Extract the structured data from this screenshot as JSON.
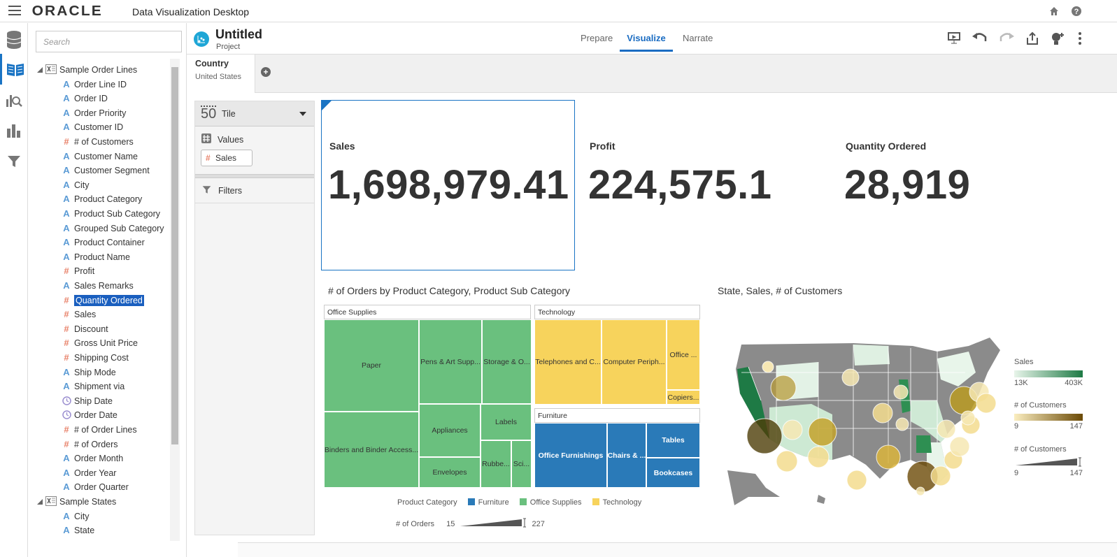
{
  "app": {
    "brand": "ORACLE",
    "name": "Data Visualization Desktop"
  },
  "top_icons": [
    "home-icon",
    "help-icon"
  ],
  "search": {
    "placeholder": "Search"
  },
  "tree": {
    "groups": [
      {
        "label": "Sample Order Lines",
        "expanded": true
      },
      {
        "label": "Sample States",
        "expanded": true
      }
    ],
    "items1": [
      {
        "type": "A",
        "label": "Order Line ID"
      },
      {
        "type": "A",
        "label": "Order ID"
      },
      {
        "type": "A",
        "label": "Order Priority"
      },
      {
        "type": "A",
        "label": "Customer ID"
      },
      {
        "type": "#",
        "label": "# of Customers"
      },
      {
        "type": "A",
        "label": "Customer Name"
      },
      {
        "type": "A",
        "label": "Customer Segment"
      },
      {
        "type": "A",
        "label": "City"
      },
      {
        "type": "A",
        "label": "Product Category"
      },
      {
        "type": "A",
        "label": "Product Sub Category"
      },
      {
        "type": "A",
        "label": "Grouped Sub Category"
      },
      {
        "type": "A",
        "label": "Product Container"
      },
      {
        "type": "A",
        "label": "Product Name"
      },
      {
        "type": "#",
        "label": "Profit"
      },
      {
        "type": "A",
        "label": "Sales Remarks"
      },
      {
        "type": "#",
        "label": "Quantity Ordered",
        "selected": true
      },
      {
        "type": "#",
        "label": "Sales"
      },
      {
        "type": "#",
        "label": "Discount"
      },
      {
        "type": "#",
        "label": "Gross Unit Price"
      },
      {
        "type": "#",
        "label": "Shipping Cost"
      },
      {
        "type": "A",
        "label": "Ship Mode"
      },
      {
        "type": "A",
        "label": "Shipment via"
      },
      {
        "type": "T",
        "label": "Ship Date"
      },
      {
        "type": "T",
        "label": "Order Date"
      },
      {
        "type": "#",
        "label": "# of Order Lines"
      },
      {
        "type": "#",
        "label": "# of Orders"
      },
      {
        "type": "A",
        "label": "Order Month"
      },
      {
        "type": "A",
        "label": "Order Year"
      },
      {
        "type": "A",
        "label": "Order Quarter"
      }
    ],
    "items2": [
      {
        "type": "A",
        "label": "City"
      },
      {
        "type": "A",
        "label": "State"
      }
    ]
  },
  "project": {
    "title": "Untitled",
    "subtitle": "Project"
  },
  "tabs": [
    {
      "label": "Prepare",
      "active": false
    },
    {
      "label": "Visualize",
      "active": true
    },
    {
      "label": "Narrate",
      "active": false
    }
  ],
  "filter": {
    "name": "Country",
    "value": "United States"
  },
  "grammar": {
    "viz_type": "Tile",
    "viz_type_icon": "50",
    "values_label": "Values",
    "values_pill": "Sales",
    "filters_label": "Filters"
  },
  "tiles": [
    {
      "label": "Sales",
      "value": "1,698,979.41"
    },
    {
      "label": "Profit",
      "value": "224,575.1"
    },
    {
      "label": "Quantity Ordered",
      "value": "28,919"
    }
  ],
  "treemap": {
    "title": "# of Orders by Product Category, Product Sub Category",
    "colors": {
      "Furniture": "#2a7ab8",
      "Office Supplies": "#6ac07e",
      "Technology": "#f7d35c"
    },
    "groups": [
      {
        "name": "Office Supplies",
        "cells": [
          "Paper",
          "Pens & Art Supp...",
          "Storage & O...",
          "Binders and Binder Access...",
          "Appliances",
          "Labels",
          "Envelopes",
          "Rubbe...",
          "Sci..."
        ]
      },
      {
        "name": "Technology",
        "cells": [
          "Telephones and C...",
          "Computer Periph...",
          "Office ...",
          "Copiers..."
        ]
      },
      {
        "name": "Furniture",
        "cells": [
          "Office Furnishings",
          "Chairs & ...",
          "Tables",
          "Bookcases"
        ]
      }
    ],
    "legend_title": "Product Category",
    "legend": [
      "Furniture",
      "Office Supplies",
      "Technology"
    ],
    "size_label": "# of Orders",
    "size_min": "15",
    "size_max": "227"
  },
  "map": {
    "title": "State, Sales, # of Customers",
    "legend": [
      {
        "title": "Sales",
        "min": "13K",
        "max": "403K",
        "from": "#e8f5ea",
        "to": "#1e7a45"
      },
      {
        "title": "# of Customers",
        "min": "9",
        "max": "147",
        "from": "#fbeec0",
        "to": "#6b4a06"
      },
      {
        "title": "# of Customers",
        "min": "9",
        "max": "147"
      }
    ]
  }
}
